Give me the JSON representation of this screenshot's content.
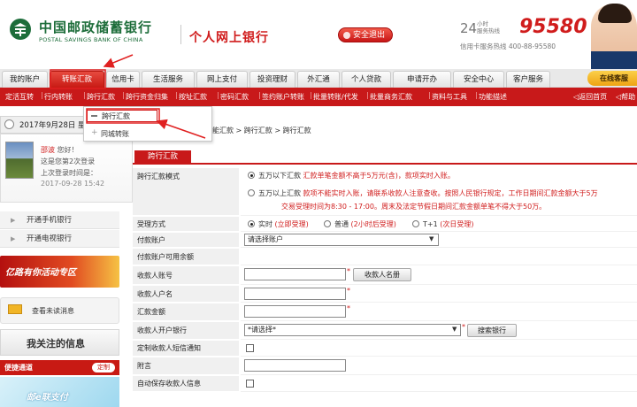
{
  "header": {
    "bank_name_cn": "中国邮政储蓄银行",
    "bank_name_en": "POSTAL SAVINGS BANK OF CHINA",
    "product": "个人网上银行",
    "logout_label": "安全退出",
    "hotline_prefix_num": "24",
    "hotline_prefix_small": "小时\n服务热线",
    "hotline_number": "95580",
    "credit_line": "信用卡服务热线 400-88-95580",
    "online_service": "在线客服"
  },
  "nav": {
    "tabs": [
      "我的账户",
      "转账汇款",
      "信用卡",
      "生活服务",
      "网上支付",
      "投资理财",
      "外汇通",
      "个人贷款",
      "申请开办",
      "安全中心",
      "客户服务"
    ],
    "active_index": 1,
    "sub_items": [
      "定活互转",
      "行内转账",
      "跨行汇款",
      "跨行资金归集",
      "按址汇款",
      "密码汇款",
      "签约账户转账",
      "批量转账/代发",
      "批量商务汇款",
      "资料与工具",
      "功能描述"
    ],
    "right_links": [
      "返回首页",
      "帮助"
    ]
  },
  "datebar": {
    "date": "2017年9月28日 星"
  },
  "user": {
    "name": "邵波",
    "greeting": "您好！",
    "login_count": "这是您第2次登录",
    "last_login_label": "上次登录时间是：",
    "last_login_time": "2017-09-28 15:42"
  },
  "left_links": [
    "开通手机银行",
    "开通电视银行"
  ],
  "promo": {
    "text": "亿路有你活动专区"
  },
  "messages": {
    "label": "查看未读消息"
  },
  "follow": {
    "label": "我关注的信息"
  },
  "quick": {
    "label": "便捷通道",
    "customize": "定制"
  },
  "ad": {
    "text": "邮e联支付"
  },
  "dropdown": {
    "items": [
      "跨行汇款",
      "同城转账"
    ]
  },
  "breadcrumb": "能汇款 > 跨行汇款 > 跨行汇款",
  "form": {
    "title": "跨行汇款",
    "rows": {
      "mode_label": "跨行汇款模式",
      "mode_opt1_a": "五万以下汇款",
      "mode_opt1_b": "汇款单笔金额不高于5万元(含)，款项实时入账。",
      "mode_opt2_a": "五万以上汇款",
      "mode_opt2_b": "款项不能实时入账，请联系收款人注意查收。按照人民银行规定，工作日期间汇款金额大于5万",
      "mode_opt2_c": "交易受理时间为8:30 - 17:00。周末及法定节假日期间汇款金额单笔不得大于50万。",
      "accept_label": "受理方式",
      "accept_opt1": "实时",
      "accept_opt1_note": "(立即受理)",
      "accept_opt2": "普通",
      "accept_opt2_note": "(2小时后受理)",
      "accept_opt3": "T+1",
      "accept_opt3_note": "(次日受理)",
      "pay_account_label": "付款账户",
      "pay_account_value": "请选择账户",
      "available_label": "付款账户可用余额",
      "payee_account_label": "收款人账号",
      "payee_list_button": "收款人名册",
      "payee_name_label": "收款人户名",
      "amount_label": "汇款金额",
      "payee_bank_label": "收款人开户银行",
      "payee_bank_value": "*请选择*",
      "search_bank_button": "搜索银行",
      "sms_label": "定制收款人短信通知",
      "memo_label": "附言",
      "autosave_label": "自动保存收款人信息"
    }
  },
  "colors": {
    "brand_red": "#c8191a",
    "brand_green": "#1d6d3a",
    "annotation_red": "#e02020"
  }
}
